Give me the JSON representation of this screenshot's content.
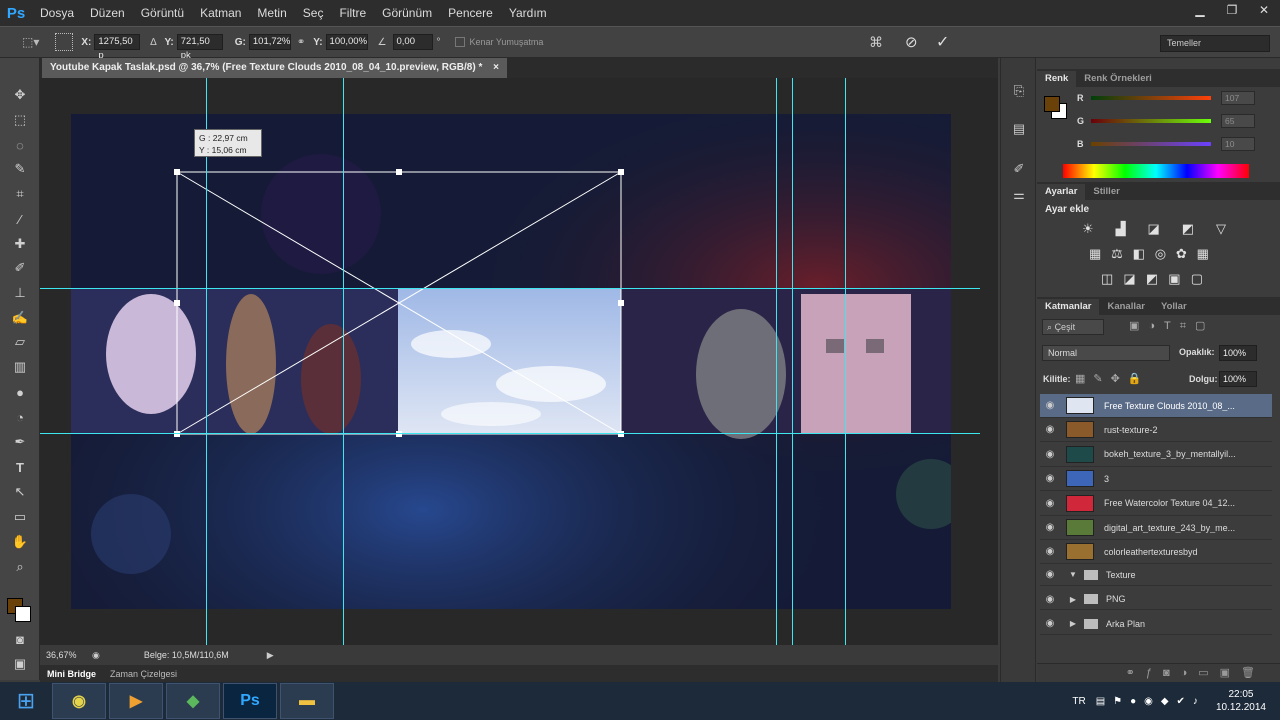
{
  "app": {
    "logo": "Ps"
  },
  "menu": [
    "Dosya",
    "Düzen",
    "Görüntü",
    "Katman",
    "Metin",
    "Seç",
    "Filtre",
    "Görünüm",
    "Pencere",
    "Yardım"
  ],
  "options": {
    "x_label": "X:",
    "x_value": "1275,50 p",
    "y_label": "Y:",
    "y_value": "721,50 pk",
    "w_label": "G:",
    "w_value": "101,72%",
    "h_label": "Y:",
    "h_value": "100,00%",
    "angle_value": "0,00",
    "degree": "°",
    "antialias_label": "Kenar Yumuşatma",
    "workspace": "Temeller"
  },
  "document": {
    "tab_title": "Youtube Kapak Taslak.psd @ 36,7% (Free Texture Clouds 2010_08_04_10.preview, RGB/8) *",
    "close_glyph": "×",
    "transform_tooltip": {
      "w": "G : 22,97 cm",
      "h": "Y : 15,06 cm"
    }
  },
  "status": {
    "zoom": "36,67%",
    "doc_info": "Belge: 10,5M/110,6M"
  },
  "bottom_tabs": [
    "Mini Bridge",
    "Zaman Çizelgesi"
  ],
  "color_panel": {
    "tabs": [
      "Renk",
      "Renk Örnekleri"
    ],
    "r_label": "R",
    "g_label": "G",
    "b_label": "B",
    "r": "107",
    "g": "65",
    "b": "10",
    "fg_color": "#6b410a"
  },
  "adjust_panel": {
    "tabs": [
      "Ayarlar",
      "Stiller"
    ],
    "heading": "Ayar ekle"
  },
  "layers_panel": {
    "tabs": [
      "Katmanlar",
      "Kanallar",
      "Yollar"
    ],
    "filter": "Çeşit",
    "blend_mode": "Normal",
    "opacity_label": "Opaklık:",
    "opacity": "100%",
    "lock_label": "Kilitle:",
    "fill_label": "Dolgu:",
    "fill": "100%",
    "layers": [
      {
        "name": "Free Texture Clouds 2010_08_...",
        "selected": true,
        "kind": "layer",
        "thumb": "#dfe6f2"
      },
      {
        "name": "rust-texture-2",
        "kind": "layer",
        "thumb": "#8a5a2a"
      },
      {
        "name": "bokeh_texture_3_by_mentallyil...",
        "kind": "layer",
        "thumb": "#1f4a4a"
      },
      {
        "name": "3",
        "kind": "layer",
        "thumb": "#3d66b8"
      },
      {
        "name": "Free Watercolor Texture 04_12...",
        "kind": "layer",
        "thumb": "#d0283a"
      },
      {
        "name": "digital_art_texture_243_by_me...",
        "kind": "layer",
        "thumb": "#5a7a3a"
      },
      {
        "name": "colorleathertexturesbyd",
        "kind": "layer",
        "thumb": "#9a7030"
      },
      {
        "name": "Texture",
        "kind": "group-open"
      },
      {
        "name": "PNG",
        "kind": "group"
      },
      {
        "name": "Arka Plan",
        "kind": "group"
      }
    ]
  },
  "taskbar": {
    "lang": "TR",
    "time": "22:05",
    "date": "10.12.2014",
    "apps": [
      "Ps"
    ]
  }
}
